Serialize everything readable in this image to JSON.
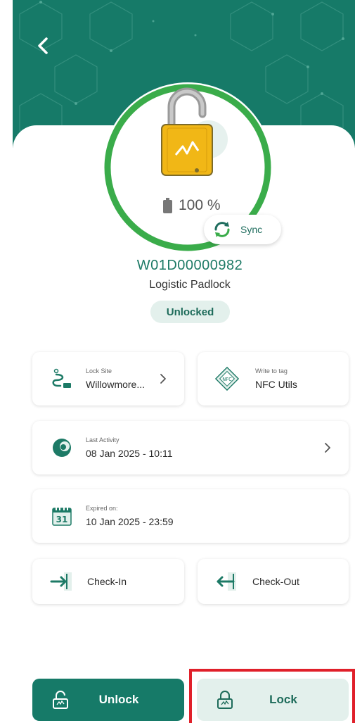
{
  "header": {
    "back_icon": "chevron-left-icon"
  },
  "lock": {
    "battery": "100 %",
    "id": "W01D00000982",
    "type": "Logistic Padlock",
    "status": "Unlocked",
    "sync_label": "Sync",
    "ring_color": "#3aac4a",
    "body_color": "#f1b716"
  },
  "cards": {
    "lock_site": {
      "label": "Lock Site",
      "value": "Willowmore..."
    },
    "nfc": {
      "label": "Write to tag",
      "value": "NFC Utils",
      "badge": "NFC"
    },
    "last_activity": {
      "label": "Last Activity",
      "value": "08 Jan 2025 - 10:11"
    },
    "expired": {
      "label": "Expired on:",
      "value": "10 Jan 2025 - 23:59",
      "calendar_day": "31"
    },
    "check_in": {
      "value": "Check-In"
    },
    "check_out": {
      "value": "Check-Out"
    }
  },
  "actions": {
    "unlock_label": "Unlock",
    "lock_label": "Lock"
  },
  "colors": {
    "primary": "#167a68",
    "accent_light": "#e3f0ec",
    "highlight": "#e0202a"
  }
}
